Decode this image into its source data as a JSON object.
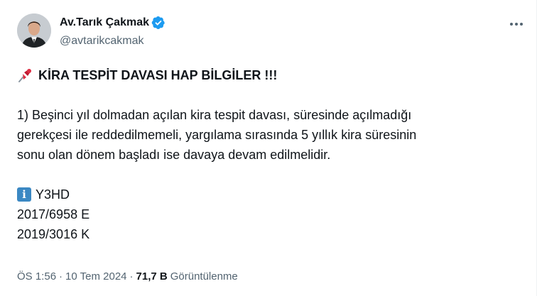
{
  "author": {
    "display_name": "Av.Tarık Çakmak",
    "handle": "@avtarikcakmak",
    "verified": true
  },
  "tweet": {
    "title": "KİRA TESPİT DAVASI HAP BİLGİLER !!!",
    "paragraph_lines": [
      "1) Beşinci yıl dolmadan açılan kira tespit davası, süresinde açılmadığı",
      "gerekçesi ile reddedilmemeli, yargılama sırasında 5 yıllık kira süresinin",
      "sonu olan dönem başladı ise  davaya devam edilmelidir."
    ],
    "info_code": "Y3HD",
    "references": [
      "2017/6958 E",
      "2019/3016 K"
    ]
  },
  "meta": {
    "time": "ÖS 1:56",
    "separator": "·",
    "date": "10 Tem 2024",
    "views_count": "71,7 B",
    "views_label": "Görüntülenme"
  },
  "icons": {
    "pin": "pushpin-icon",
    "info": "information-icon",
    "verified": "verified-badge-icon",
    "more": "more-options-icon"
  },
  "colors": {
    "text": "#0f1419",
    "secondary": "#536471",
    "verified_blue": "#1d9bf0",
    "info_blue": "#3b88c3",
    "pin_red": "#be1931"
  }
}
